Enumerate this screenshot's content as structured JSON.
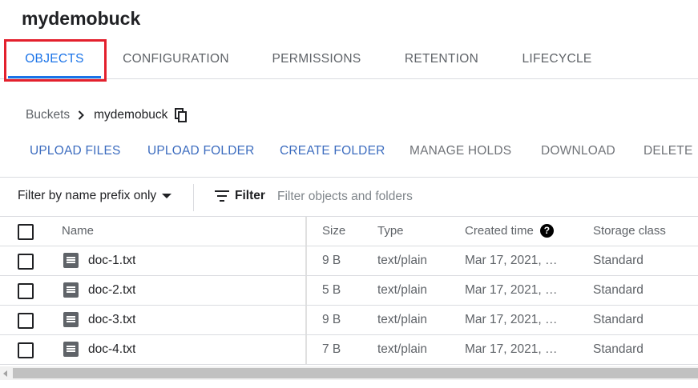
{
  "bucket_title": "mydemobuck",
  "tabs": [
    {
      "label": "OBJECTS",
      "active": true
    },
    {
      "label": "CONFIGURATION",
      "active": false
    },
    {
      "label": "PERMISSIONS",
      "active": false
    },
    {
      "label": "RETENTION",
      "active": false
    },
    {
      "label": "LIFECYCLE",
      "active": false
    }
  ],
  "breadcrumb": {
    "root": "Buckets",
    "current": "mydemobuck"
  },
  "actions": [
    {
      "label": "UPLOAD FILES",
      "enabled": true
    },
    {
      "label": "UPLOAD FOLDER",
      "enabled": true
    },
    {
      "label": "CREATE FOLDER",
      "enabled": true
    },
    {
      "label": "MANAGE HOLDS",
      "enabled": false
    },
    {
      "label": "DOWNLOAD",
      "enabled": false
    },
    {
      "label": "DELETE",
      "enabled": false
    }
  ],
  "filter": {
    "prefix_select": "Filter by name prefix only",
    "label": "Filter",
    "placeholder": "Filter objects and folders"
  },
  "table": {
    "columns": [
      "Name",
      "Size",
      "Type",
      "Created time",
      "Storage class"
    ],
    "rows": [
      {
        "name": "doc-1.txt",
        "size": "9 B",
        "type": "text/plain",
        "created": "Mar 17, 2021, …",
        "storage": "Standard"
      },
      {
        "name": "doc-2.txt",
        "size": "5 B",
        "type": "text/plain",
        "created": "Mar 17, 2021, …",
        "storage": "Standard"
      },
      {
        "name": "doc-3.txt",
        "size": "9 B",
        "type": "text/plain",
        "created": "Mar 17, 2021, …",
        "storage": "Standard"
      },
      {
        "name": "doc-4.txt",
        "size": "7 B",
        "type": "text/plain",
        "created": "Mar 17, 2021, …",
        "storage": "Standard"
      }
    ]
  },
  "icons": {
    "copy": "copy-icon",
    "chevron": "chevron-right-icon",
    "filter": "filter-icon",
    "help": "help-icon",
    "file": "file-icon"
  },
  "colors": {
    "accent": "#1a73e8",
    "highlight": "#e3202d",
    "action_enabled": "#3c6cbf",
    "action_disabled": "#707378"
  }
}
